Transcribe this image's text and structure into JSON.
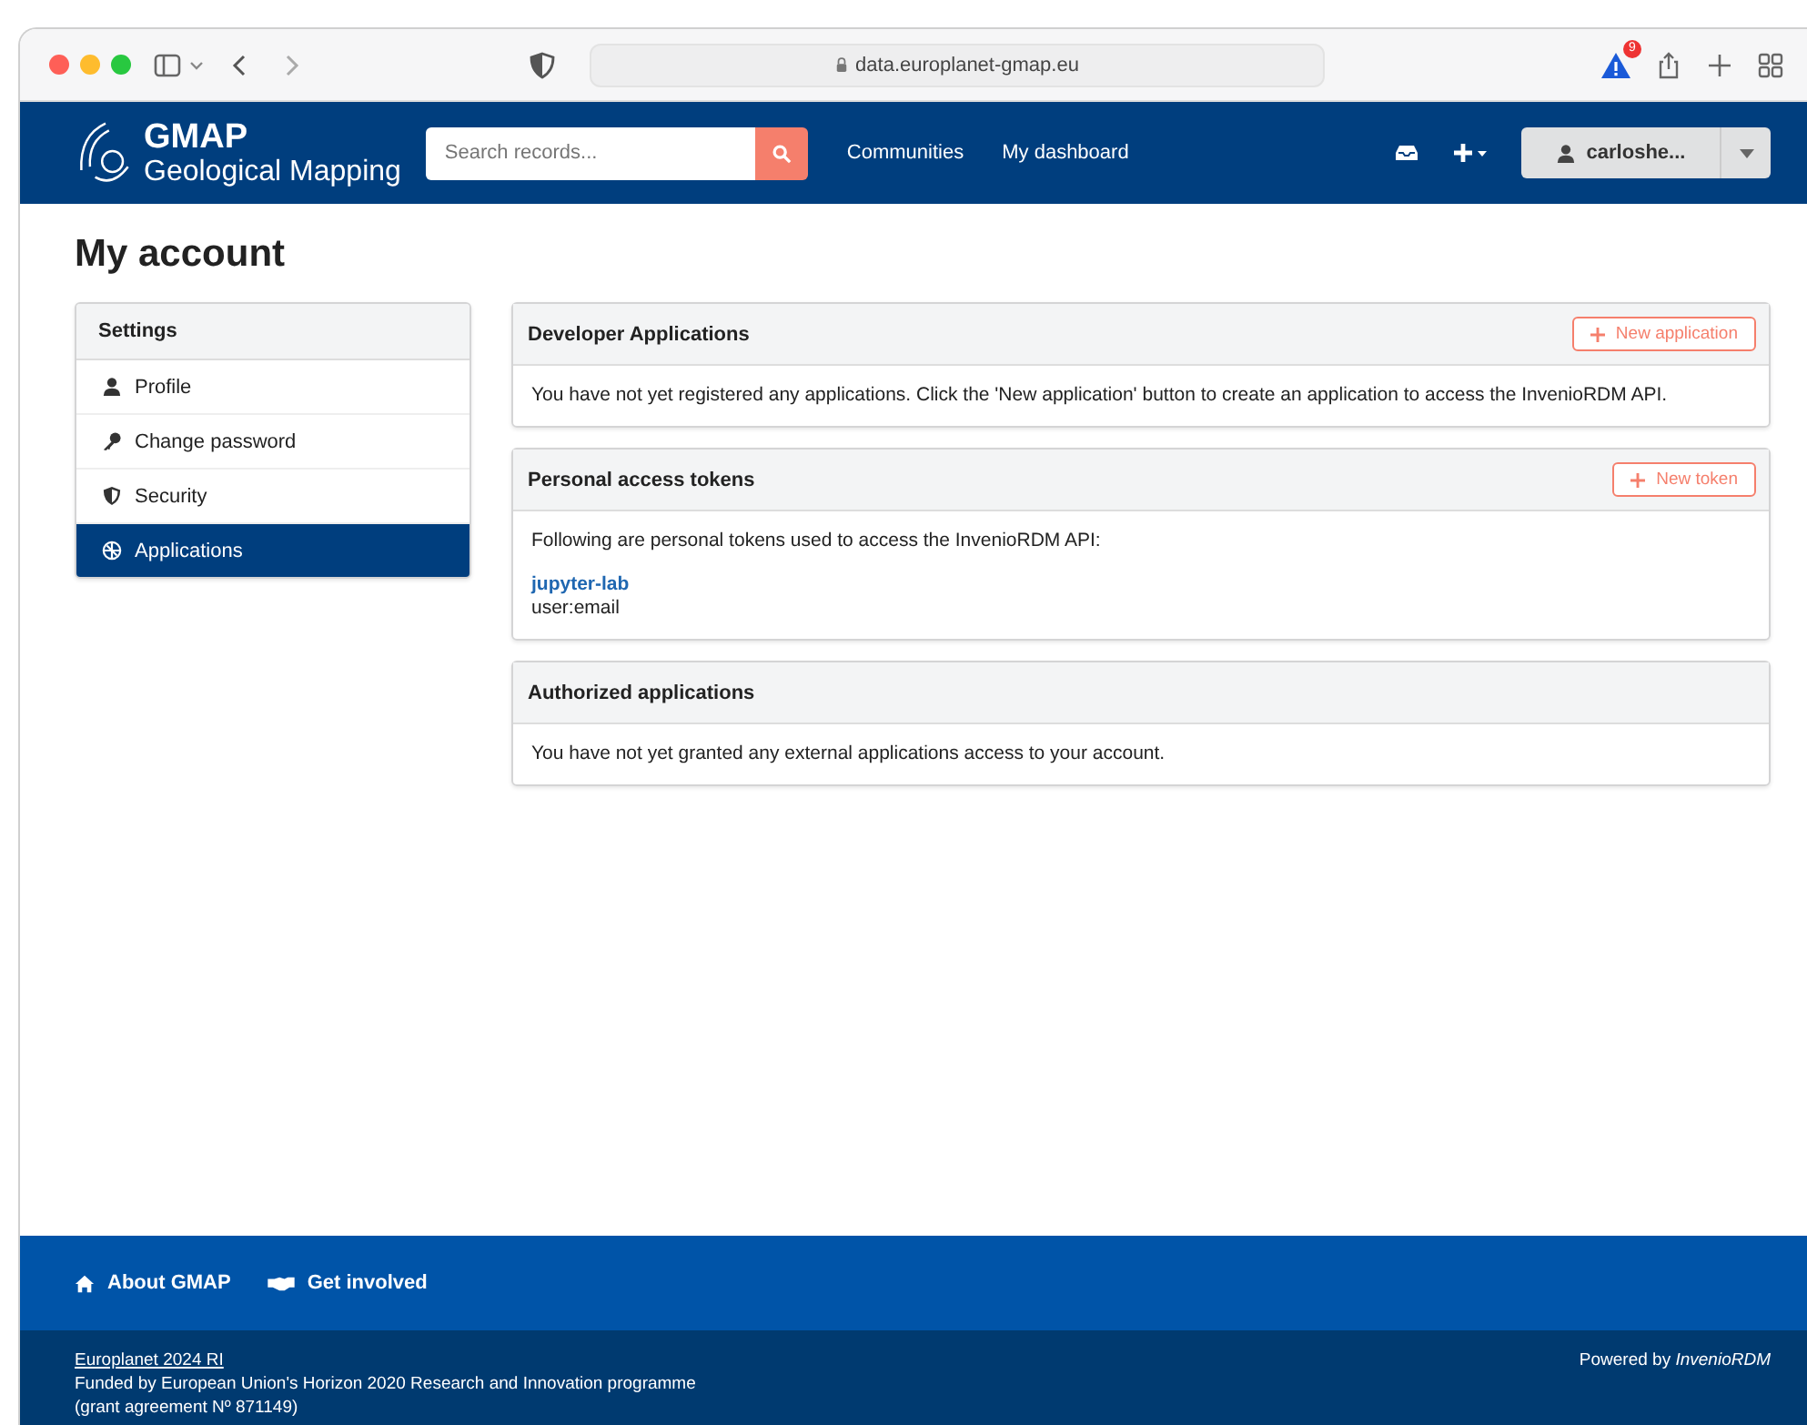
{
  "browser": {
    "url": "data.europlanet-gmap.eu",
    "badge": "9"
  },
  "header": {
    "logo_title": "GMAP",
    "logo_subtitle": "Geological Mapping",
    "search": {
      "placeholder": "Search records..."
    },
    "nav": [
      "Communities",
      "My dashboard"
    ],
    "user": "carloshe..."
  },
  "page_title": "My account",
  "sidebar": {
    "title": "Settings",
    "items": [
      {
        "label": "Profile",
        "kind": "user",
        "selected": false
      },
      {
        "label": "Change password",
        "kind": "key",
        "selected": false
      },
      {
        "label": "Security",
        "kind": "shield",
        "selected": false
      },
      {
        "label": "Applications",
        "kind": "apps",
        "selected": true
      }
    ]
  },
  "panels": [
    {
      "title": "Developer Applications",
      "button": "New application",
      "text": "You have not yet registered any applications. Click the 'New application' button to create an application to access the InvenioRDM API."
    },
    {
      "title": "Personal access tokens",
      "button": "New token",
      "text": "Following are personal tokens used to access the InvenioRDM API:",
      "tokens": [
        {
          "name": "jupyter-lab",
          "scope": "user:email"
        }
      ]
    },
    {
      "title": "Authorized applications",
      "text": "You have not yet granted any external applications access to your account."
    }
  ],
  "footer": {
    "links": [
      {
        "label": "About GMAP",
        "kind": "home"
      },
      {
        "label": "Get involved",
        "kind": "hands"
      }
    ],
    "org": "Europlanet 2024 RI",
    "funding": "Funded by European Union's Horizon 2020 Research and Innovation programme",
    "grant": "(grant agreement Nº 871149)",
    "powered": "Powered by *InvenioRDM*"
  }
}
